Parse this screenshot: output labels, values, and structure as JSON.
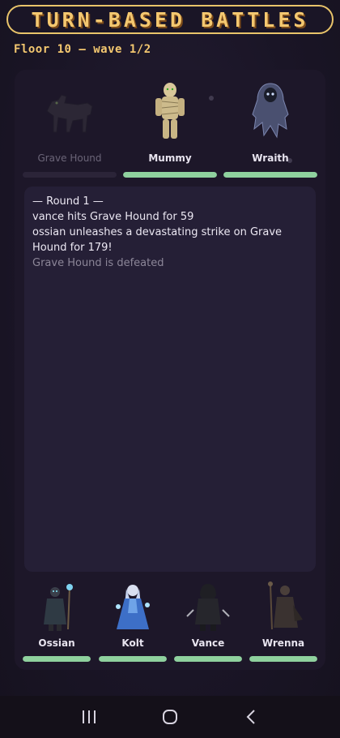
{
  "header": {
    "title": "TURN-BASED BATTLES",
    "floor_wave": "Floor 10 — wave 1/2"
  },
  "enemies": [
    {
      "name": "Grave Hound",
      "icon": "hound-icon",
      "state": "defeated",
      "hp_fraction": 0
    },
    {
      "name": "Mummy",
      "icon": "mummy-icon",
      "state": "alive",
      "hp_fraction": 1
    },
    {
      "name": "Wraith",
      "icon": "wraith-icon",
      "state": "alive",
      "hp_fraction": 1
    }
  ],
  "log": {
    "lines": [
      {
        "text": "— Round 1 —"
      },
      {
        "text": "vance hits Grave Hound for 59"
      },
      {
        "text": "ossian unleashes a devastating strike on Grave Hound for 179!"
      },
      {
        "text": "Grave Hound is defeated"
      }
    ]
  },
  "heroes": [
    {
      "name": "Ossian",
      "icon": "mage-icon",
      "hp_fraction": 1
    },
    {
      "name": "Kolt",
      "icon": "ice-sorceress-icon",
      "hp_fraction": 1
    },
    {
      "name": "Vance",
      "icon": "rogue-icon",
      "hp_fraction": 1
    },
    {
      "name": "Wrenna",
      "icon": "druid-icon",
      "hp_fraction": 1
    }
  ],
  "colors": {
    "accent_gold": "#f4c870",
    "hp_green": "#8fd19e",
    "panel_bg": "#1d1729"
  },
  "navbar": {
    "icons": [
      "recent-apps-icon",
      "home-icon",
      "back-icon"
    ]
  }
}
